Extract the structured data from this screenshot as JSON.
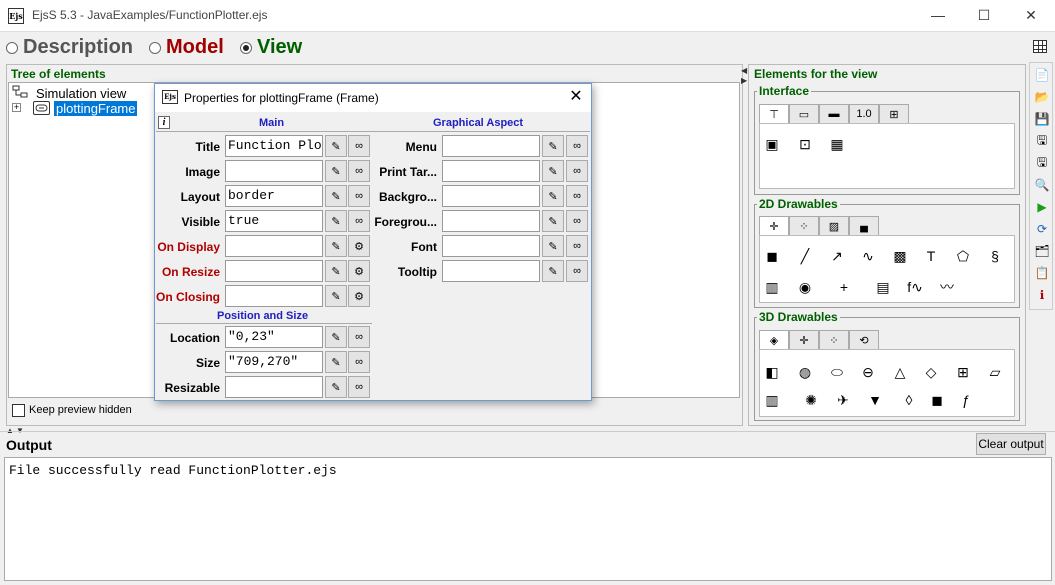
{
  "window": {
    "title": "EjsS 5.3 - JavaExamples/FunctionPlotter.ejs",
    "app_icon_text": "Ejs",
    "minimize": "—",
    "maximize": "☐",
    "close": "✕"
  },
  "modes": {
    "description": "Description",
    "model": "Model",
    "view": "View",
    "selected": "View"
  },
  "tree": {
    "header": "Tree of elements",
    "root_label": "Simulation view",
    "child_label": "plottingFrame",
    "keep_preview_label": "Keep preview hidden"
  },
  "palette": {
    "header": "Elements for the view",
    "groups": [
      {
        "title": "Interface"
      },
      {
        "title": "2D Drawables"
      },
      {
        "title": "3D Drawables"
      }
    ],
    "interface_tabs": [
      "⊤",
      "▭",
      "▬",
      "1.0",
      "⊞"
    ],
    "interface_icons": [
      "▣",
      "⊡",
      "▦"
    ],
    "drawables2d_tabs": [
      "✛",
      "⁘",
      "▨",
      "▄"
    ],
    "drawables2d_icons_row1": [
      "◼",
      "╱",
      "↗",
      "∿",
      "▩",
      "T",
      "⬠",
      "§"
    ],
    "drawables2d_icons_row2": [
      "▥",
      "◉",
      "+",
      "▤",
      "f∿",
      "〰"
    ],
    "drawables3d_tabs": [
      "◈",
      "✛",
      "⁘",
      "⟲"
    ],
    "drawables3d_icons_row1": [
      "◧",
      "◍",
      "⬭",
      "⊖",
      "△",
      "◇",
      "⊞",
      "▱"
    ],
    "drawables3d_icons_row2": [
      "▥",
      "✺",
      "✈",
      "▼",
      "◊",
      "◼",
      "ƒ"
    ]
  },
  "toolbar": [
    "📄",
    "📂",
    "💾",
    "🖫",
    "🖫",
    "🔍",
    "▶",
    "⟳",
    "🗂",
    "📋",
    "ℹ"
  ],
  "dialog": {
    "title": "Properties for plottingFrame (Frame)",
    "icon_text": "Ejs",
    "close": "✕",
    "info": "i",
    "sections": {
      "main": "Main",
      "graphical": "Graphical Aspect",
      "position": "Position and Size"
    },
    "main_props": [
      {
        "label": "Title",
        "value": "Function Plo"
      },
      {
        "label": "Image",
        "value": ""
      },
      {
        "label": "Layout",
        "value": "border"
      },
      {
        "label": "Visible",
        "value": "true"
      },
      {
        "label": "On Display",
        "value": ""
      },
      {
        "label": "On Resize",
        "value": ""
      },
      {
        "label": "On Closing",
        "value": ""
      }
    ],
    "graphical_props": [
      {
        "label": "Menu",
        "value": ""
      },
      {
        "label": "Print Tar...",
        "value": ""
      },
      {
        "label": "Backgro...",
        "value": ""
      },
      {
        "label": "Foregrou...",
        "value": ""
      },
      {
        "label": "Font",
        "value": ""
      },
      {
        "label": "Tooltip",
        "value": ""
      }
    ],
    "position_props": [
      {
        "label": "Location",
        "value": "\"0,23\""
      },
      {
        "label": "Size",
        "value": "\"709,270\""
      },
      {
        "label": "Resizable",
        "value": ""
      }
    ],
    "edit_glyph": "✎",
    "link_glyph": "∞",
    "action_glyph": "⚙"
  },
  "output": {
    "title": "Output",
    "clear_button": "Clear output",
    "text": "File successfully read FunctionPlotter.ejs"
  }
}
